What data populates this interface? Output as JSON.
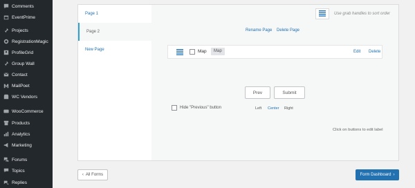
{
  "sidebar": {
    "items": [
      {
        "label": "Comments",
        "icon": "comment-icon"
      },
      {
        "label": "EventPrime",
        "icon": "calendar-icon"
      },
      {
        "label": "Projects",
        "icon": "pin-icon"
      },
      {
        "label": "RegistrationMagic",
        "icon": "magic-icon"
      },
      {
        "label": "ProfileGrid",
        "icon": "profile-icon"
      },
      {
        "label": "Group Wall",
        "icon": "pin-icon"
      },
      {
        "label": "Contact",
        "icon": "mail-icon"
      },
      {
        "label": "MailPoet",
        "icon": "mailpoet-icon"
      },
      {
        "label": "WC Vendors",
        "icon": "store-icon"
      },
      {
        "label": "WooCommerce",
        "icon": "woo-icon"
      },
      {
        "label": "Products",
        "icon": "archive-icon"
      },
      {
        "label": "Analytics",
        "icon": "chart-icon"
      },
      {
        "label": "Marketing",
        "icon": "megaphone-icon"
      },
      {
        "label": "Forums",
        "icon": "forums-icon"
      },
      {
        "label": "Topics",
        "icon": "topics-icon"
      },
      {
        "label": "Replies",
        "icon": "replies-icon"
      }
    ]
  },
  "pages": [
    {
      "label": "Page 1",
      "active": false
    },
    {
      "label": "Page 2",
      "active": true
    },
    {
      "label": "New Page",
      "active": false
    }
  ],
  "toolbar": {
    "sort_hint": "Use grab handles to sort order",
    "rename_page": "Rename Page",
    "delete_page": "Delete Page"
  },
  "field": {
    "label": "Map",
    "type": "Map",
    "edit": "Edit",
    "delete": "Delete"
  },
  "nav_buttons": {
    "prev": "Prev",
    "submit": "Submit"
  },
  "hide_prev_label": "Hide \"Previous\" button",
  "alignment": {
    "left": "Left",
    "center": "Center",
    "right": "Right",
    "selected": "Center"
  },
  "edit_hint": "Click on buttons to edit label",
  "footer": {
    "all_forms": "All Forms",
    "form_dashboard": "Form Dashboard"
  },
  "colors": {
    "sidebar_bg": "#23282d",
    "accent": "#2271b1",
    "active_tab_border": "#2ea2cc"
  }
}
